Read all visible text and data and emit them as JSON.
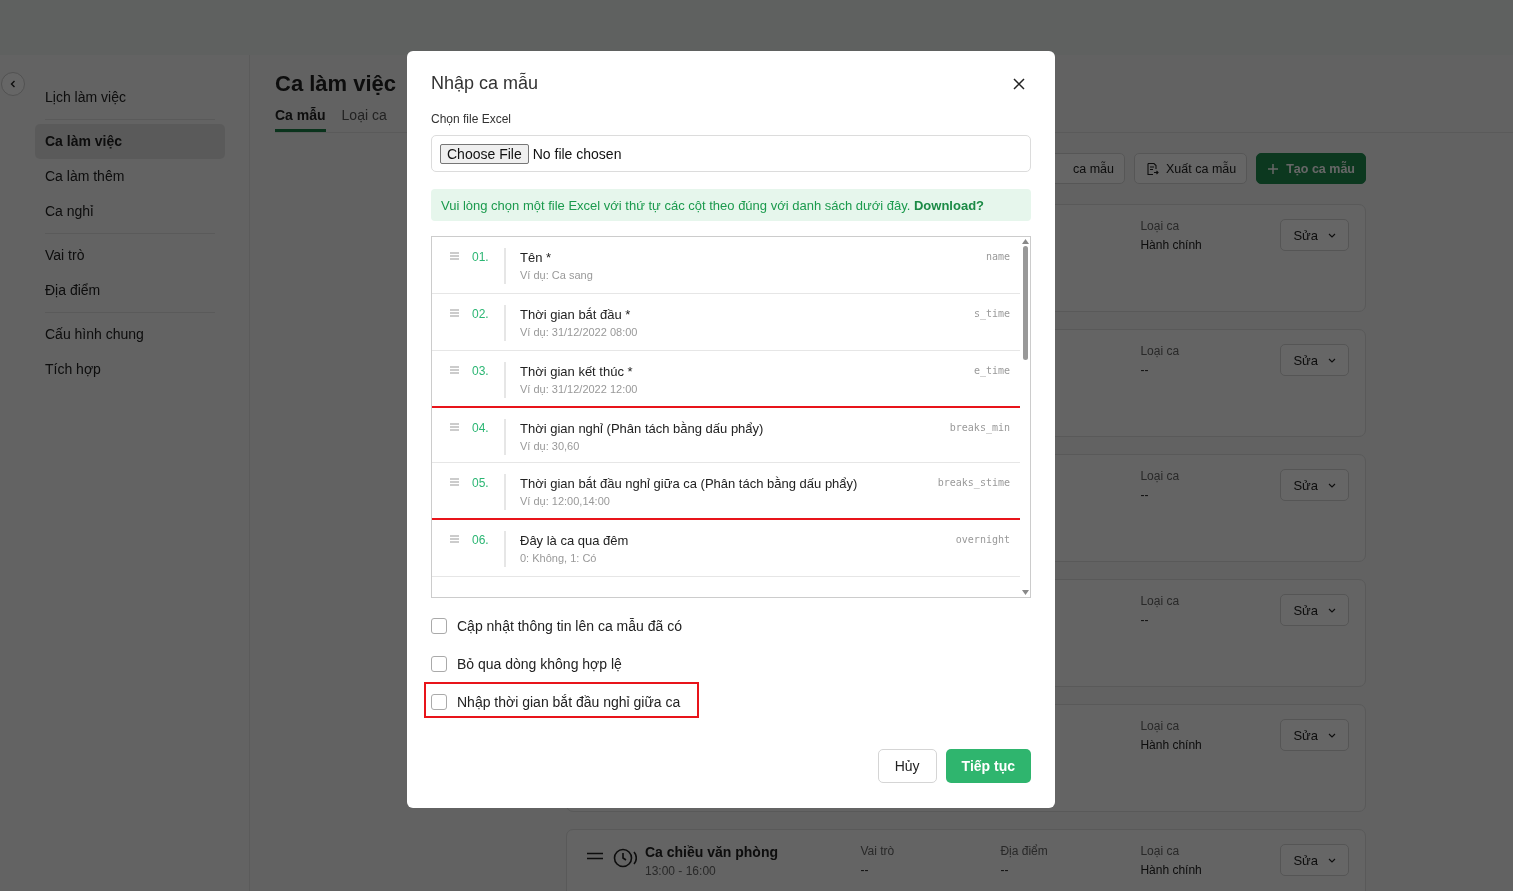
{
  "sidebar": {
    "groups": [
      {
        "items": [
          {
            "label": "Lịch làm việc",
            "selected": false
          }
        ]
      },
      {
        "items": [
          {
            "label": "Ca làm việc",
            "selected": true
          },
          {
            "label": "Ca làm thêm",
            "selected": false
          },
          {
            "label": "Ca nghỉ",
            "selected": false
          }
        ]
      },
      {
        "items": [
          {
            "label": "Vai trò",
            "selected": false
          },
          {
            "label": "Địa điểm",
            "selected": false
          }
        ]
      },
      {
        "items": [
          {
            "label": "Cấu hình chung",
            "selected": false
          },
          {
            "label": "Tích hợp",
            "selected": false
          }
        ]
      }
    ]
  },
  "page": {
    "title": "Ca làm việc",
    "tabs": [
      {
        "label": "Ca mẫu",
        "selected": true
      },
      {
        "label": "Loại ca",
        "selected": false
      }
    ]
  },
  "toolbar": [
    {
      "label": "ca mẫu",
      "kind": "plain"
    },
    {
      "label": "Xuất ca mẫu",
      "kind": "export"
    },
    {
      "label": "Tạo ca mẫu",
      "kind": "create"
    }
  ],
  "cards": [
    {
      "fields": [
        {
          "label": "Loại ca",
          "value": "Hành chính"
        }
      ],
      "action": "Sửa"
    },
    {
      "fields": [
        {
          "label": "Loại ca",
          "value": "--"
        }
      ],
      "action": "Sửa"
    },
    {
      "fields": [
        {
          "label": "Loại ca",
          "value": "--"
        }
      ],
      "action": "Sửa"
    },
    {
      "fields": [
        {
          "label": "Loại ca",
          "value": "--"
        }
      ],
      "action": "Sửa"
    },
    {
      "fields": [
        {
          "label": "Loại ca",
          "value": "Hành chính"
        }
      ],
      "action": "Sửa"
    },
    {
      "title": "Ca chiều văn phòng",
      "time": "13:00 - 16:00",
      "fields": [
        {
          "label": "Vai trò",
          "value": "--"
        },
        {
          "label": "Địa điểm",
          "value": "--"
        },
        {
          "label": "Loại ca",
          "value": "Hành chính"
        }
      ],
      "action": "Sửa"
    }
  ],
  "modal": {
    "title": "Nhập ca mẫu",
    "file_label": "Chọn file Excel",
    "file_button": "Choose File",
    "file_status": "No file chosen",
    "notice": "Vui lòng chọn một file Excel với thứ tự các cột theo đúng với danh sách dưới đây.",
    "notice_link": "Download?",
    "columns": [
      {
        "number": "01.",
        "title": "Tên *",
        "example": "Ví dụ: Ca sang",
        "key": "name",
        "highlighted": false
      },
      {
        "number": "02.",
        "title": "Thời gian bắt đầu *",
        "example": "Ví dụ: 31/12/2022 08:00",
        "key": "s_time",
        "highlighted": false
      },
      {
        "number": "03.",
        "title": "Thời gian kết thúc *",
        "example": "Ví dụ: 31/12/2022 12:00",
        "key": "e_time",
        "highlighted": false
      },
      {
        "number": "04.",
        "title": "Thời gian nghỉ (Phân tách bằng dấu phẩy)",
        "example": "Ví dụ: 30,60",
        "key": "breaks_min",
        "highlighted": true
      },
      {
        "number": "05.",
        "title": "Thời gian bắt đầu nghỉ giữa ca (Phân tách bằng dấu phẩy)",
        "example": "Ví dụ: 12:00,14:00",
        "key": "breaks_stime",
        "highlighted": true
      },
      {
        "number": "06.",
        "title": "Đây là ca qua đêm",
        "example": "0: Không, 1: Có",
        "key": "overnight",
        "highlighted": false
      }
    ],
    "options": [
      {
        "label": "Cập nhật thông tin lên ca mẫu đã có",
        "checked": false,
        "highlighted": false
      },
      {
        "label": "Bỏ qua dòng không hợp lệ",
        "checked": false,
        "highlighted": false
      },
      {
        "label": "Nhập thời gian bắt đầu nghỉ giữa ca",
        "checked": false,
        "highlighted": true
      }
    ],
    "cancel": "Hủy",
    "submit": "Tiếp tục"
  }
}
